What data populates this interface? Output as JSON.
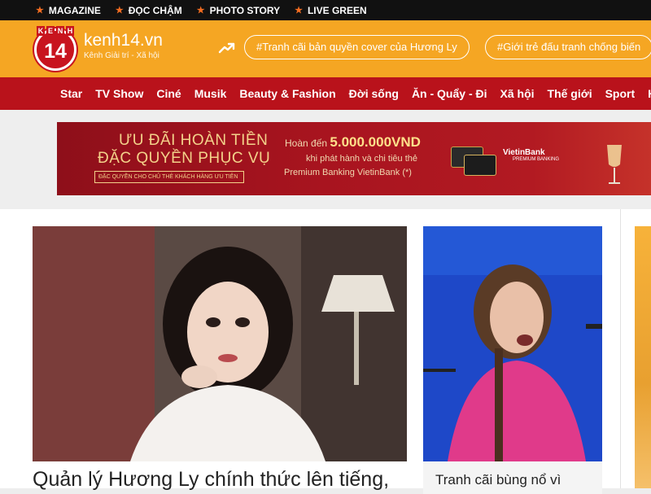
{
  "topbar": {
    "links": [
      {
        "label": "MAGAZINE"
      },
      {
        "label": "ĐỌC CHẬM"
      },
      {
        "label": "PHOTO STORY"
      },
      {
        "label": "LIVE GREEN"
      }
    ]
  },
  "header": {
    "logo_letters": [
      "K",
      "E",
      "N",
      "H"
    ],
    "logo_number": "14",
    "brand_name": "kenh14.vn",
    "brand_sub": "Kênh Giải trí - Xã hội",
    "hashtags": [
      {
        "label": "#Tranh cãi bản quyền cover của Hương Ly"
      },
      {
        "label": "#Giới trẻ đấu tranh chống biến"
      }
    ]
  },
  "nav": {
    "items": [
      {
        "label": "Star"
      },
      {
        "label": "TV Show"
      },
      {
        "label": "Ciné"
      },
      {
        "label": "Musik"
      },
      {
        "label": "Beauty & Fashion"
      },
      {
        "label": "Đời sống"
      },
      {
        "label": "Ăn - Quẩy - Đi"
      },
      {
        "label": "Xã hội"
      },
      {
        "label": "Thế giới"
      },
      {
        "label": "Sport"
      },
      {
        "label": "H"
      }
    ]
  },
  "ad": {
    "headline1": "ƯU ĐÃI HOÀN TIỀN",
    "headline2": "ĐẶC QUYỀN PHỤC VỤ",
    "tagline": "ĐẶC QUYỀN CHO CHỦ THẺ KHÁCH HÀNG ƯU TIÊN",
    "refund_prefix": "Hoàn đến",
    "refund_amount": "5.000.000VND",
    "line2": "khi phát hành và chi tiêu thẻ",
    "line3": "Premium Banking VietinBank (*)",
    "bank_name": "VietinBank",
    "bank_sub": "PREMIUM BANKING"
  },
  "articles": {
    "main_title": "Quản lý Hương Ly chính thức lên tiếng,",
    "side_title": "Tranh cãi bùng nổ vì"
  },
  "colors": {
    "topbar": "#111111",
    "header": "#f5a623",
    "nav": "#b9121b",
    "star": "#f36d21"
  }
}
